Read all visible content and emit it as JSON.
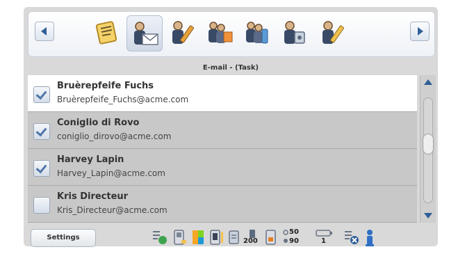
{
  "toolbar": {
    "caption": "E-mail - (Task)",
    "icons": [
      {
        "name": "notes-icon"
      },
      {
        "name": "contact-email-icon",
        "selected": true
      },
      {
        "name": "contact-edit-icon"
      },
      {
        "name": "contact-group-icon"
      },
      {
        "name": "contact-phone-icon"
      },
      {
        "name": "contact-card-icon"
      },
      {
        "name": "contact-note-icon"
      }
    ]
  },
  "contacts": [
    {
      "name": "Bruèrepfeife Fuchs",
      "email": "Bruèrepfeife_Fuchs@acme.com",
      "checked": true,
      "selected": true
    },
    {
      "name": "Coniglio di Rovo",
      "email": "coniglio_dirovo@acme.com",
      "checked": true
    },
    {
      "name": "Harvey Lapin",
      "email": "Harvey_Lapin@acme.com",
      "checked": true
    },
    {
      "name": "Kris Directeur",
      "email": "Kris_Directeur@acme.com",
      "checked": false
    }
  ],
  "statusbar": {
    "settings_label": "Settings",
    "sms_count": "200",
    "signal_top": "50",
    "signal_bottom": "90",
    "battery_count": "1"
  },
  "colors": {
    "accent": "#2f5f97",
    "row_bg": "#c8c8c8",
    "row_selected_bg": "#ffffff"
  }
}
